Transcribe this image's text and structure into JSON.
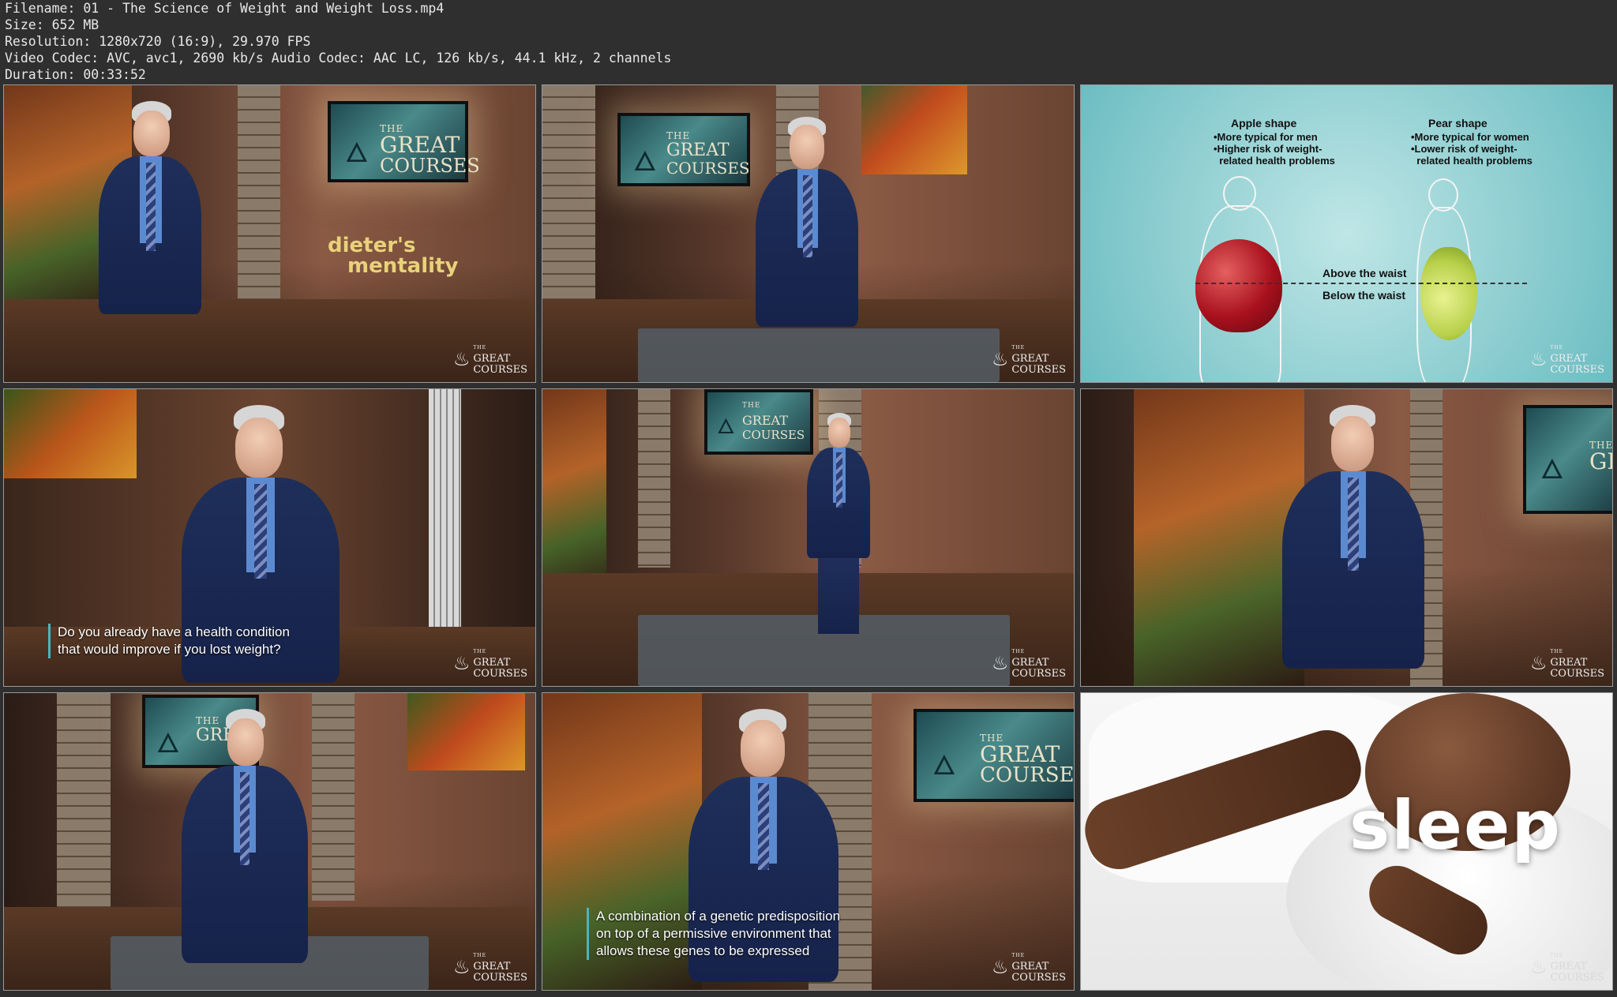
{
  "header": {
    "filename": "Filename: 01 - The Science of Weight and Weight Loss.mp4",
    "size": "Size: 652 MB",
    "resolution": "Resolution: 1280x720 (16:9), 29.970 FPS",
    "codec": "Video Codec: AVC, avc1, 2690 kb/s Audio Codec: AAC LC, 126 kb/s, 44.1 kHz, 2 channels",
    "duration": "Duration: 00:33:52"
  },
  "brand": {
    "the": "THE",
    "great": "GREAT",
    "courses": "COURSES",
    "tv_great": "GREAT",
    "tv_courses": "COURSES"
  },
  "thumbs": {
    "t1": {
      "overlay_line1": "dieter's",
      "overlay_line2": "mentality"
    },
    "t3": {
      "apple_title": "Apple shape",
      "apple_points": "•More typical for men\n•Higher risk of weight-\n  related health problems",
      "pear_title": "Pear shape",
      "pear_points": "•More typical for women\n•Lower risk of weight-\n  related health problems",
      "above": "Above the waist",
      "below": "Below the waist"
    },
    "t4": {
      "caption": "Do you already have a health condition\nthat would improve if you lost weight?"
    },
    "t8": {
      "caption": "A combination of a genetic predisposition\non top of a permissive environment that\nallows these genes to be expressed"
    },
    "t9": {
      "word": "sleep"
    }
  },
  "colors": {
    "background": "#2f2f2f",
    "caption_bar": "#4bb4c0",
    "overlay_text": "#e9d27a"
  }
}
